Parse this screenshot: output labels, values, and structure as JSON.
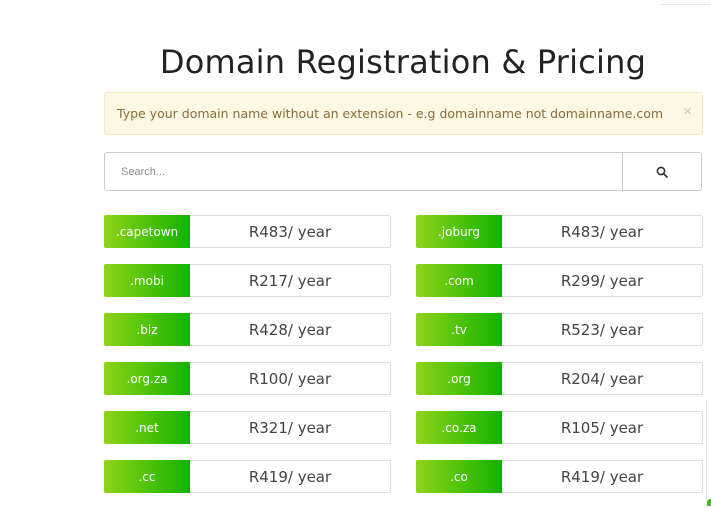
{
  "page": {
    "title": "Domain Registration & Pricing"
  },
  "alert": {
    "message": "Type your domain name without an extension - e.g domainname not domainname.com",
    "close_glyph": "×"
  },
  "search": {
    "placeholder": "Search...",
    "value": "",
    "button_icon": "search-icon"
  },
  "domains": [
    {
      "ext": ".capetown",
      "price": "R483/ year"
    },
    {
      "ext": ".joburg",
      "price": "R483/ year"
    },
    {
      "ext": ".mobi",
      "price": "R217/ year"
    },
    {
      "ext": ".com",
      "price": "R299/ year"
    },
    {
      "ext": ".biz",
      "price": "R428/ year"
    },
    {
      "ext": ".tv",
      "price": "R523/ year"
    },
    {
      "ext": ".org.za",
      "price": "R100/ year"
    },
    {
      "ext": ".org",
      "price": "R204/ year"
    },
    {
      "ext": ".net",
      "price": "R321/ year"
    },
    {
      "ext": ".co.za",
      "price": "R105/ year"
    },
    {
      "ext": ".cc",
      "price": "R419/ year"
    },
    {
      "ext": ".co",
      "price": "R419/ year"
    }
  ],
  "colors": {
    "accent_green": "#14b200",
    "accent_green_light": "#8fd21a",
    "alert_bg": "#fcf8e3",
    "alert_text": "#8a6d3b"
  }
}
